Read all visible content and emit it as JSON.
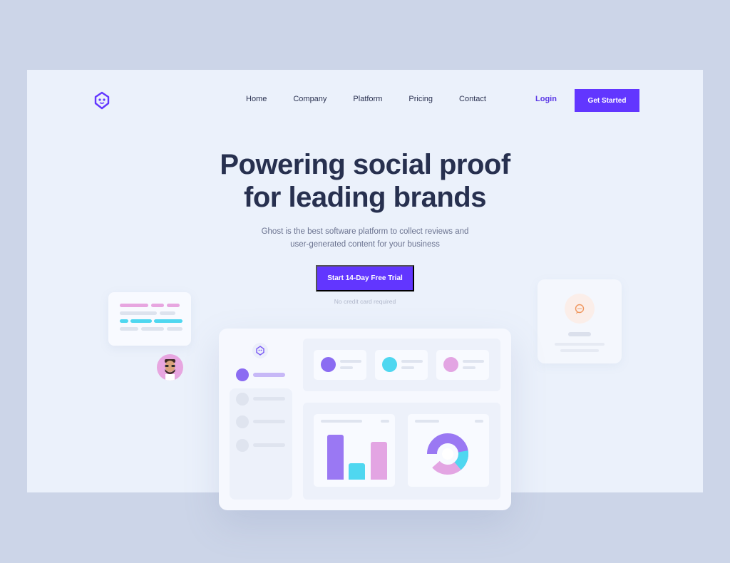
{
  "brand": {
    "logo_icon": "ghost-logo-icon",
    "accent": "#6236ff"
  },
  "nav": {
    "items": [
      "Home",
      "Company",
      "Platform",
      "Pricing",
      "Contact"
    ],
    "login": "Login",
    "get_started": "Get Started"
  },
  "hero": {
    "title_line1": "Powering social proof",
    "title_line2": "for leading brands",
    "subtitle_line1": "Ghost is the best software platform to collect reviews and",
    "subtitle_line2": "user-generated content for your business",
    "cta": "Start 14-Day Free Trial",
    "note": "No credit card required"
  },
  "colors": {
    "background": "#ccd5e8",
    "frame": "#ebf1fb",
    "heading": "#27304f",
    "purple": "#8b6cf2",
    "cyan": "#4fd7f0",
    "pink": "#e3a5e3"
  },
  "icons": {
    "chat": "chat-bubble-icon",
    "avatar": "user-avatar"
  }
}
